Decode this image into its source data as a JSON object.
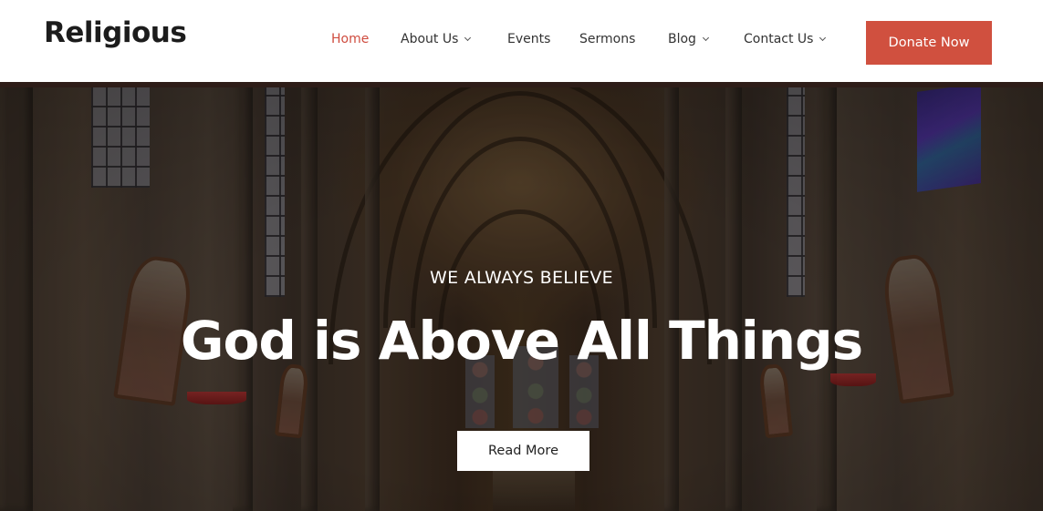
{
  "header": {
    "logo": "Religious",
    "nav": [
      {
        "label": "Home",
        "active": true,
        "has_dropdown": false
      },
      {
        "label": "About Us",
        "active": false,
        "has_dropdown": true
      },
      {
        "label": "Events",
        "active": false,
        "has_dropdown": false
      },
      {
        "label": "Sermons",
        "active": false,
        "has_dropdown": false
      },
      {
        "label": "Blog",
        "active": false,
        "has_dropdown": true
      },
      {
        "label": "Contact Us",
        "active": false,
        "has_dropdown": true
      }
    ],
    "cta_label": "Donate Now"
  },
  "hero": {
    "eyebrow": "WE ALWAYS BELIEVE",
    "headline": "God is Above All Things",
    "button_label": "Read More",
    "background_image": "cathedral-interior"
  },
  "colors": {
    "accent": "#d0503f",
    "active_nav": "#cf4c3f",
    "text_dark": "#1c1c1c",
    "nav_text": "#333333"
  }
}
